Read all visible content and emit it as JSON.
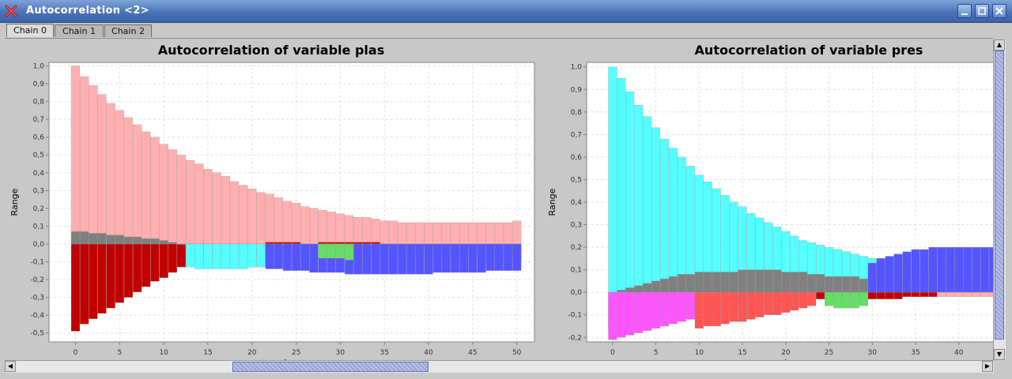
{
  "window": {
    "title": "Autocorrelation <2>",
    "tabs": [
      "Chain 0",
      "Chain 1",
      "Chain 2"
    ],
    "active_tab": "Chain 0"
  },
  "colors": {
    "plas_positive": "#ffafaf",
    "plas_negative": "#c00000",
    "plas_gray": "#808080",
    "plas_cyan": "#55ffff",
    "plas_blue": "#5555ff",
    "plas_green": "#66dd66",
    "pres_cyan": "#55ffff",
    "pres_gray": "#808080",
    "pres_blue": "#5555ff",
    "pres_red": "#c00000",
    "pres_pink": "#ffafaf",
    "pres_magenta": "#ff55ff",
    "pres_lightred": "#ff5555"
  },
  "chart_data": [
    {
      "type": "bar",
      "title": "Autocorrelation of variable plas",
      "xlabel": "Lag",
      "ylabel": "Range",
      "xlim": [
        -3,
        52
      ],
      "ylim": [
        -0.55,
        1.02
      ],
      "x_ticks": [
        "0",
        "5",
        "10",
        "15",
        "20",
        "25",
        "30",
        "35",
        "40",
        "45",
        "50"
      ],
      "y_ticks": [
        "-0,5",
        "-0,4",
        "-0,3",
        "-0,2",
        "-0,1",
        "0,0",
        "0,1",
        "0,2",
        "0,3",
        "0,4",
        "0,5",
        "0,6",
        "0,7",
        "0,8",
        "0,9",
        "1,0"
      ],
      "grid": true,
      "series": [
        {
          "name": "series-pink",
          "color": "#ffafaf",
          "values": [
            1.0,
            0.94,
            0.89,
            0.84,
            0.79,
            0.75,
            0.71,
            0.67,
            0.63,
            0.6,
            0.56,
            0.53,
            0.5,
            0.47,
            0.45,
            0.42,
            0.4,
            0.38,
            0.35,
            0.33,
            0.31,
            0.29,
            0.28,
            0.26,
            0.24,
            0.23,
            0.21,
            0.2,
            0.19,
            0.18,
            0.17,
            0.16,
            0.15,
            0.15,
            0.14,
            0.13,
            0.13,
            0.12,
            0.12,
            0.12,
            0.12,
            0.12,
            0.12,
            0.12,
            0.12,
            0.12,
            0.12,
            0.12,
            0.12,
            0.12,
            0.13
          ]
        },
        {
          "name": "series-darkred",
          "color": "#c00000",
          "values": [
            -0.49,
            -0.45,
            -0.42,
            -0.39,
            -0.36,
            -0.33,
            -0.3,
            -0.27,
            -0.24,
            -0.21,
            -0.19,
            -0.16,
            -0.13,
            -0.11,
            -0.09,
            -0.07,
            -0.05,
            -0.03,
            -0.02,
            -0.01,
            0.0,
            0.0,
            0.01,
            0.01,
            0.01,
            0.01,
            0.0,
            0.0,
            0.01,
            0.01,
            0.01,
            0.01,
            0.01,
            0.01,
            0.01,
            0.0,
            0.0,
            0.0,
            0.0,
            0.0,
            -0.02,
            -0.03,
            -0.04,
            -0.04,
            -0.05,
            -0.06,
            -0.07,
            -0.08,
            -0.08,
            -0.09,
            -0.1
          ]
        },
        {
          "name": "series-gray",
          "color": "#808080",
          "values": [
            0.07,
            0.07,
            0.06,
            0.06,
            0.05,
            0.05,
            0.04,
            0.04,
            0.03,
            0.03,
            0.02,
            0.01,
            0.0,
            -0.01,
            -0.02,
            -0.03,
            -0.04,
            -0.04,
            -0.05,
            -0.05,
            -0.05,
            -0.05,
            -0.05,
            -0.05,
            -0.05,
            -0.05,
            -0.06,
            -0.06,
            -0.06,
            -0.06,
            -0.07,
            -0.07,
            -0.07,
            -0.07,
            -0.07,
            -0.07,
            -0.07,
            -0.07,
            -0.07,
            -0.07,
            -0.07,
            -0.07,
            -0.07,
            -0.07,
            -0.07,
            -0.07,
            -0.08,
            -0.08,
            -0.09,
            -0.1,
            -0.1
          ]
        },
        {
          "name": "series-cyan",
          "color": "#55ffff",
          "values": [
            null,
            null,
            null,
            null,
            null,
            null,
            null,
            null,
            null,
            null,
            null,
            null,
            null,
            -0.13,
            -0.14,
            -0.14,
            -0.14,
            -0.14,
            -0.14,
            -0.14,
            -0.13,
            -0.13,
            -0.12,
            -0.12,
            -0.11,
            -0.11,
            -0.1,
            -0.09,
            -0.09,
            -0.08,
            -0.08,
            -0.07,
            -0.07,
            -0.06,
            null,
            null,
            null,
            null,
            null,
            null,
            null,
            null,
            null,
            null,
            null,
            null,
            null,
            null,
            null,
            null,
            null
          ]
        },
        {
          "name": "series-blue",
          "color": "#5555ff",
          "values": [
            null,
            null,
            null,
            null,
            null,
            null,
            null,
            null,
            null,
            null,
            null,
            null,
            null,
            null,
            null,
            null,
            null,
            null,
            null,
            null,
            null,
            null,
            -0.14,
            -0.14,
            -0.15,
            -0.15,
            -0.15,
            -0.16,
            -0.16,
            -0.16,
            -0.16,
            -0.17,
            -0.17,
            -0.17,
            -0.17,
            -0.17,
            -0.17,
            -0.17,
            -0.17,
            -0.17,
            -0.17,
            -0.16,
            -0.16,
            -0.16,
            -0.16,
            -0.16,
            -0.16,
            -0.15,
            -0.15,
            -0.15,
            -0.15
          ]
        },
        {
          "name": "series-green",
          "color": "#66dd66",
          "values": [
            null,
            null,
            null,
            null,
            null,
            null,
            null,
            null,
            null,
            null,
            null,
            null,
            null,
            null,
            null,
            null,
            null,
            null,
            null,
            null,
            null,
            null,
            null,
            null,
            null,
            null,
            null,
            null,
            -0.08,
            -0.08,
            -0.08,
            -0.09,
            null,
            null,
            null,
            null,
            null,
            null,
            null,
            null,
            null,
            null,
            null,
            null,
            null,
            null,
            null,
            null,
            null,
            null,
            null
          ]
        }
      ]
    },
    {
      "type": "bar",
      "title": "Autocorrelation of variable pres",
      "xlabel": "Lag",
      "ylabel": "Range",
      "xlim": [
        -3,
        44.5
      ],
      "ylim": [
        -0.22,
        1.02
      ],
      "x_ticks": [
        "0",
        "5",
        "10",
        "15",
        "20",
        "25",
        "30",
        "35",
        "40"
      ],
      "y_ticks": [
        "-0,2",
        "-0,1",
        "0,0",
        "0,1",
        "0,2",
        "0,3",
        "0,4",
        "0,5",
        "0,6",
        "0,7",
        "0,8",
        "0,9",
        "1,0"
      ],
      "grid": true,
      "series": [
        {
          "name": "series-cyan",
          "color": "#55ffff",
          "values": [
            1.0,
            0.95,
            0.89,
            0.83,
            0.78,
            0.73,
            0.68,
            0.64,
            0.6,
            0.56,
            0.52,
            0.49,
            0.46,
            0.43,
            0.4,
            0.38,
            0.35,
            0.33,
            0.31,
            0.29,
            0.27,
            0.25,
            0.23,
            0.22,
            0.21,
            0.2,
            0.19,
            0.18,
            0.17,
            0.16,
            0.15,
            0.15,
            0.14,
            0.14,
            0.13,
            0.12,
            0.11,
            0.1,
            0.09,
            0.08,
            0.07,
            0.06,
            0.06,
            0.06,
            0.05
          ]
        },
        {
          "name": "series-gray",
          "color": "#808080",
          "values": [
            0.0,
            0.01,
            0.02,
            0.03,
            0.04,
            0.05,
            0.06,
            0.07,
            0.08,
            0.08,
            0.09,
            0.09,
            0.09,
            0.09,
            0.09,
            0.1,
            0.1,
            0.1,
            0.1,
            0.1,
            0.09,
            0.09,
            0.09,
            0.08,
            0.08,
            0.07,
            0.07,
            0.07,
            0.07,
            0.06,
            0.06,
            0.06,
            0.06,
            0.06,
            0.06,
            0.06,
            0.06,
            0.06,
            0.06,
            0.06,
            0.06,
            0.06,
            0.06,
            0.06,
            0.06
          ]
        },
        {
          "name": "series-blue",
          "color": "#5555ff",
          "values": [
            null,
            null,
            null,
            null,
            null,
            null,
            null,
            null,
            null,
            null,
            null,
            null,
            null,
            null,
            null,
            null,
            null,
            null,
            null,
            null,
            null,
            null,
            null,
            null,
            null,
            null,
            null,
            null,
            null,
            null,
            0.13,
            0.15,
            0.16,
            0.17,
            0.18,
            0.19,
            0.19,
            0.2,
            0.2,
            0.2,
            0.2,
            0.2,
            0.2,
            0.2,
            0.2
          ]
        },
        {
          "name": "series-darkred",
          "color": "#c00000",
          "values": [
            -0.15,
            -0.15,
            -0.14,
            -0.13,
            -0.12,
            -0.12,
            -0.11,
            -0.1,
            -0.1,
            -0.09,
            -0.09,
            -0.08,
            -0.08,
            -0.07,
            -0.07,
            -0.06,
            -0.06,
            -0.05,
            -0.05,
            -0.05,
            -0.04,
            -0.04,
            -0.03,
            -0.03,
            -0.03,
            -0.03,
            -0.03,
            -0.03,
            -0.03,
            -0.03,
            -0.03,
            -0.03,
            -0.03,
            -0.03,
            -0.02,
            -0.02,
            -0.02,
            -0.02,
            -0.01,
            -0.01,
            -0.01,
            -0.01,
            -0.01,
            -0.01,
            -0.01
          ]
        },
        {
          "name": "series-pink",
          "color": "#ffafaf",
          "values": [
            -0.18,
            -0.17,
            -0.16,
            -0.15,
            -0.15,
            -0.14,
            -0.13,
            -0.12,
            -0.11,
            -0.1,
            -0.1,
            -0.09,
            -0.09,
            -0.08,
            -0.08,
            -0.07,
            -0.07,
            -0.06,
            -0.06,
            -0.05,
            null,
            null,
            null,
            null,
            null,
            null,
            null,
            null,
            null,
            null,
            null,
            null,
            null,
            null,
            null,
            null,
            null,
            null,
            -0.02,
            -0.02,
            -0.02,
            -0.02,
            -0.02,
            -0.02,
            -0.02
          ]
        },
        {
          "name": "series-magenta",
          "color": "#ff55ff",
          "values": [
            -0.21,
            -0.2,
            -0.19,
            -0.18,
            -0.17,
            -0.16,
            -0.15,
            -0.14,
            -0.13,
            -0.12,
            -0.12,
            -0.11,
            -0.1,
            -0.09,
            -0.09,
            -0.08,
            -0.08,
            -0.07,
            -0.07,
            null,
            null,
            null,
            null,
            null,
            null,
            null,
            null,
            null,
            null,
            null,
            null,
            null,
            null,
            null,
            null,
            null,
            null,
            null,
            null,
            null,
            null,
            null,
            null,
            null,
            null
          ]
        },
        {
          "name": "series-lightred",
          "color": "#ff5555",
          "values": [
            null,
            null,
            null,
            null,
            null,
            null,
            null,
            null,
            null,
            null,
            -0.16,
            -0.15,
            -0.15,
            -0.14,
            -0.13,
            -0.13,
            -0.12,
            -0.11,
            -0.1,
            -0.1,
            -0.09,
            -0.08,
            -0.07,
            -0.06,
            null,
            null,
            null,
            null,
            null,
            null,
            null,
            null,
            null,
            null,
            null,
            null,
            null,
            null,
            null,
            null,
            null,
            null,
            null,
            null,
            null
          ]
        },
        {
          "name": "series-green",
          "color": "#66dd66",
          "values": [
            null,
            null,
            null,
            null,
            null,
            null,
            null,
            null,
            null,
            null,
            null,
            null,
            null,
            null,
            null,
            null,
            null,
            null,
            null,
            null,
            null,
            null,
            null,
            null,
            null,
            -0.06,
            -0.07,
            -0.07,
            -0.07,
            -0.06,
            null,
            null,
            null,
            null,
            null,
            null,
            null,
            null,
            null,
            null,
            null,
            null,
            null,
            null,
            null
          ]
        }
      ]
    }
  ]
}
